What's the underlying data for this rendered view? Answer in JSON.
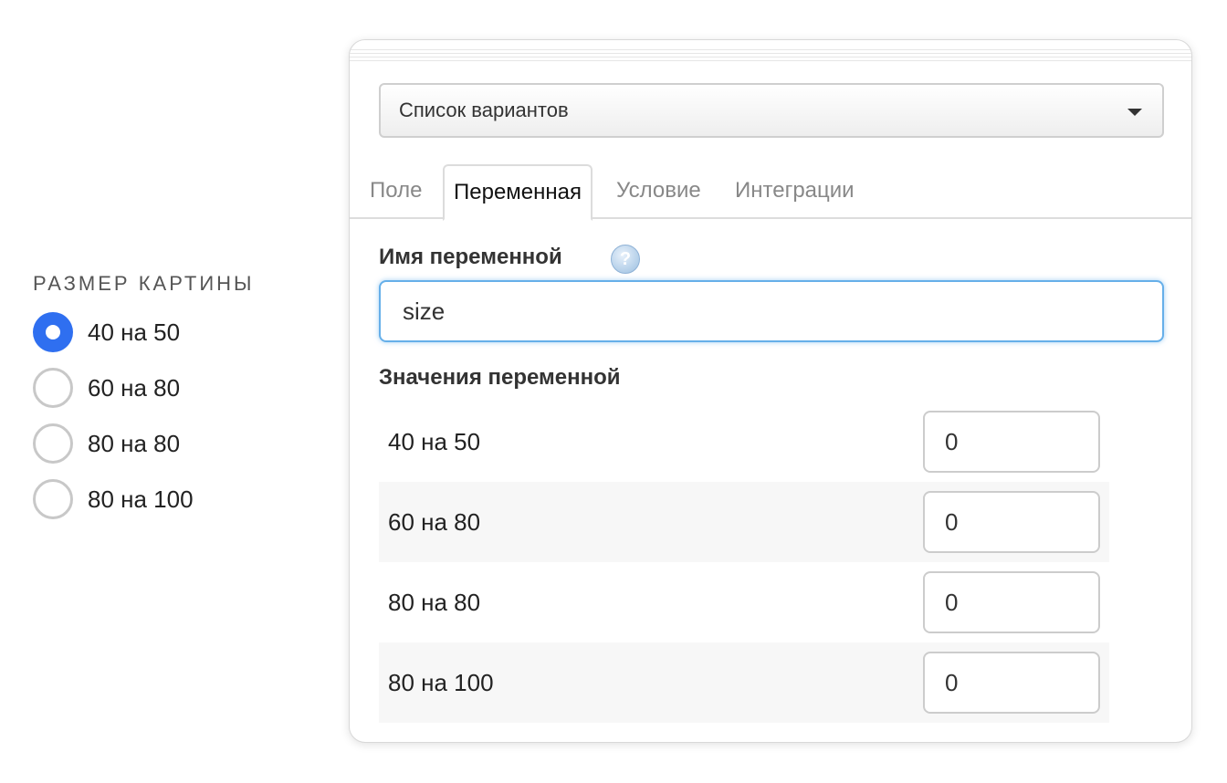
{
  "preview": {
    "title": "РАЗМЕР КАРТИНЫ",
    "options": [
      {
        "label": "40 на 50",
        "checked": true
      },
      {
        "label": "60 на 80",
        "checked": false
      },
      {
        "label": "80 на 80",
        "checked": false
      },
      {
        "label": "80 на 100",
        "checked": false
      }
    ]
  },
  "panel": {
    "field_type_select": "Список вариантов",
    "tabs": [
      {
        "label": "Поле",
        "active": false
      },
      {
        "label": "Переменная",
        "active": true
      },
      {
        "label": "Условие",
        "active": false
      },
      {
        "label": "Интеграции",
        "active": false
      }
    ],
    "variable_name_label": "Имя переменной",
    "help_icon": "question-icon",
    "help_glyph": "?",
    "variable_name_value": "size",
    "variable_values_label": "Значения переменной",
    "values": [
      {
        "label": "40 на 50",
        "value": "0"
      },
      {
        "label": "60 на 80",
        "value": "0"
      },
      {
        "label": "80 на 80",
        "value": "0"
      },
      {
        "label": "80 на 100",
        "value": "0"
      }
    ]
  },
  "colors": {
    "accent": "#2f6ff0",
    "focus": "#66afe9"
  }
}
